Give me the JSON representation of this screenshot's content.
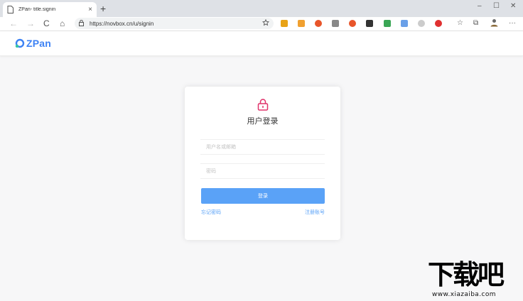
{
  "browser": {
    "tab": {
      "title": "ZPan- title.signin",
      "close": "×"
    },
    "new_tab": "+",
    "window_controls": {
      "minimize": "–",
      "maximize": "☐",
      "close": "✕"
    },
    "nav": {
      "back": "←",
      "forward": "→",
      "reload": "C",
      "home": "⌂"
    },
    "address_bar": {
      "url": "https://novbox.cn/u/signin"
    },
    "toolbar_icons": {
      "favorites": "☆",
      "collections": "⧉",
      "more": "···"
    },
    "extension_colors": [
      "#e8a317",
      "#f0a030",
      "#e8552a",
      "#888888",
      "#e8552a",
      "#333333",
      "#3aa655",
      "#6aa0e8",
      "#cccccc",
      "#e03030"
    ]
  },
  "app": {
    "logo": {
      "text": "ZPan",
      "color": "#3d82f4"
    },
    "login": {
      "title": "用户登录",
      "username_placeholder": "用户名或邮箱",
      "password_placeholder": "密码",
      "submit_label": "登录",
      "forgot_link": "忘记密码",
      "register_link": "注册账号",
      "accent_color": "#5aa2f7",
      "lock_color": "#e0336b"
    }
  },
  "watermark": {
    "title": "下载吧",
    "url": "www.xiazaiba.com"
  }
}
